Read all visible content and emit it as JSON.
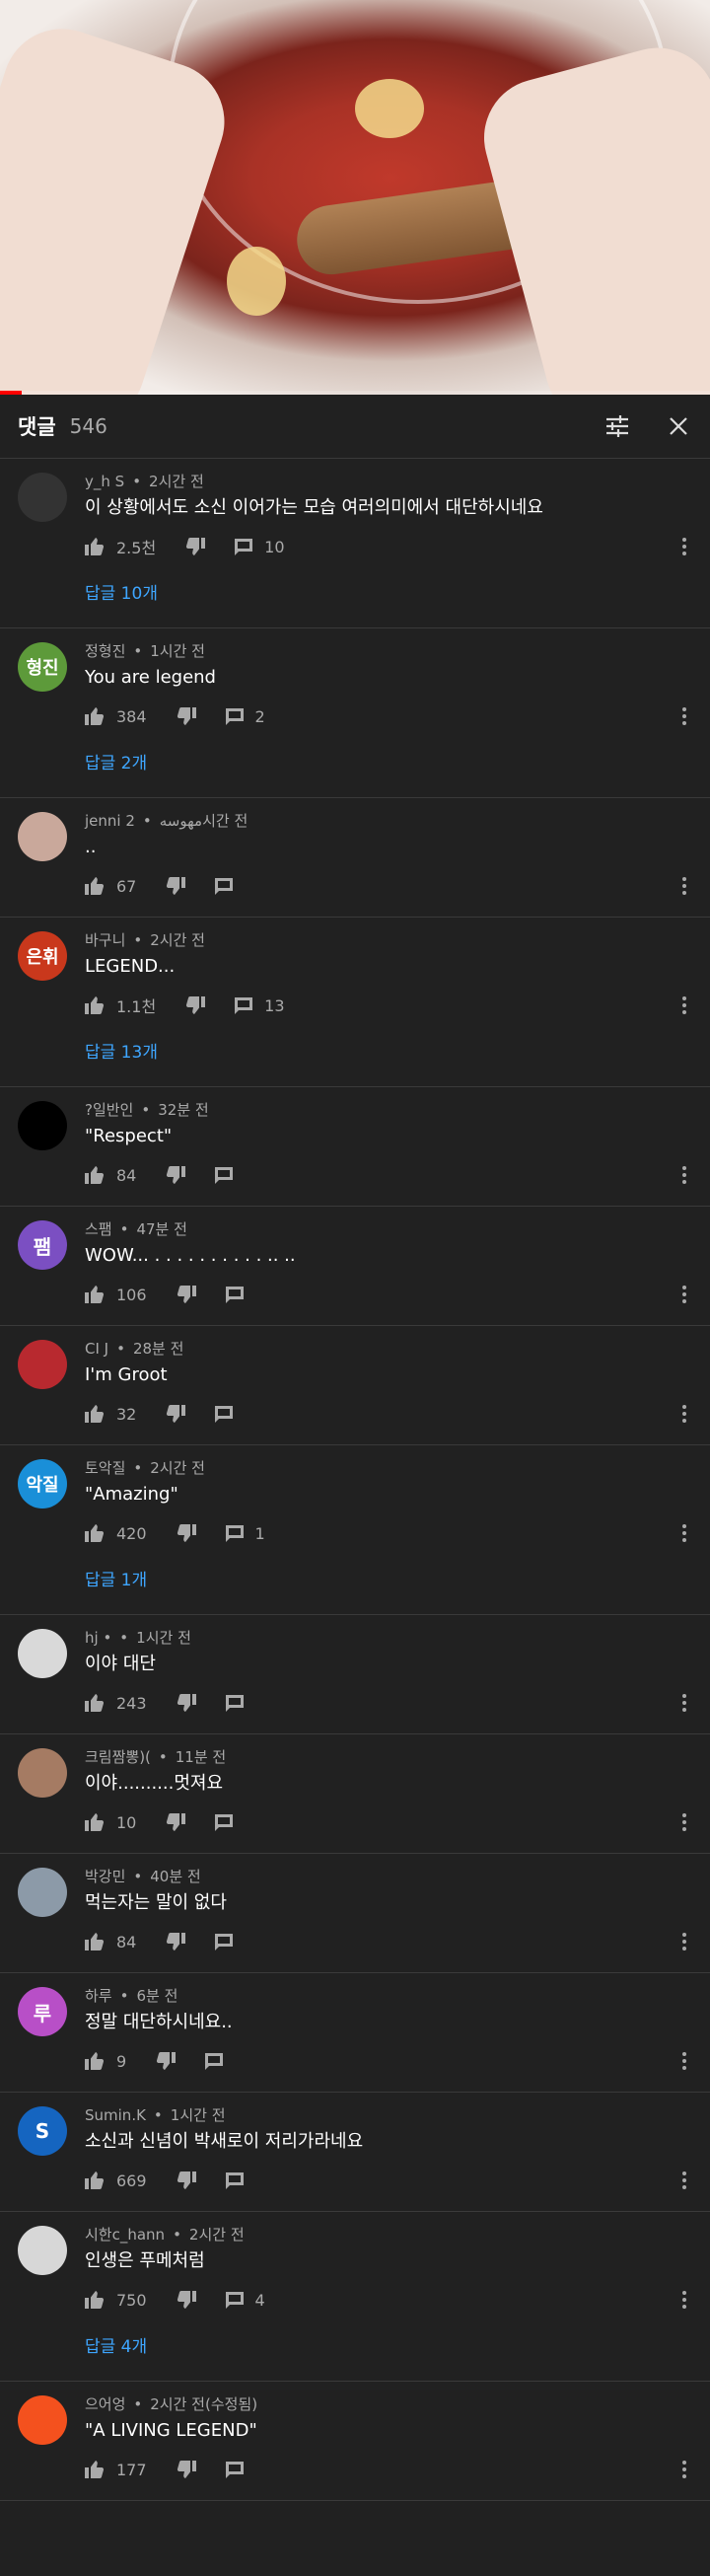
{
  "header": {
    "title": "댓글",
    "count": "546",
    "filter_icon": "filter-icon",
    "close_icon": "close-icon"
  },
  "video": {
    "progress_fraction": 0.03,
    "accent_color": "#ff0000"
  },
  "comments": [
    {
      "author": "y_h S",
      "time": "2시간 전",
      "text": "이 상황에서도 소신 이어가는 모습 여러의미에서 대단하시네요",
      "likes": "2.5천",
      "replies_count": "10",
      "replies_label": "답글 10개",
      "avatar_letter": "",
      "avatar_color": "#333333"
    },
    {
      "author": "정형진",
      "time": "1시간 전",
      "text": "You are legend",
      "likes": "384",
      "replies_count": "2",
      "replies_label": "답글 2개",
      "avatar_letter": "형진",
      "avatar_color": "#5d9a3a"
    },
    {
      "author": "jenni مهوسه",
      "time": "2시간 전",
      "text": "..",
      "likes": "67",
      "replies_count": "",
      "replies_label": "",
      "avatar_letter": "",
      "avatar_color": "#c9a89b"
    },
    {
      "author": "바구니",
      "time": "2시간 전",
      "text": "LEGEND...",
      "likes": "1.1천",
      "replies_count": "13",
      "replies_label": "답글 13개",
      "avatar_letter": "은휘",
      "avatar_color": "#c9381c"
    },
    {
      "author": "?일반인",
      "time": "32분 전",
      "text": "\"Respect\"",
      "likes": "84",
      "replies_count": "",
      "replies_label": "",
      "avatar_letter": "",
      "avatar_color": "#000000"
    },
    {
      "author": "스팸",
      "time": "47분 전",
      "text": "WOW... . . . . . . . . . . .. ..",
      "likes": "106",
      "replies_count": "",
      "replies_label": "",
      "avatar_letter": "팸",
      "avatar_color": "#7b4fc2"
    },
    {
      "author": "CI J",
      "time": "28분 전",
      "text": "I'm Groot",
      "likes": "32",
      "replies_count": "",
      "replies_label": "",
      "avatar_letter": "",
      "avatar_color": "#b8292f"
    },
    {
      "author": "토악질",
      "time": "2시간 전",
      "text": "\"Amazing\"",
      "likes": "420",
      "replies_count": "1",
      "replies_label": "답글 1개",
      "avatar_letter": "악질",
      "avatar_color": "#1a8fd8"
    },
    {
      "author": "hj •",
      "time": "1시간 전",
      "text": "이야 대단",
      "likes": "243",
      "replies_count": "",
      "replies_label": "",
      "avatar_letter": "",
      "avatar_color": "#d9d9d9"
    },
    {
      "author": "크림짬뽕)(",
      "time": "11분 전",
      "text": "이야..........멋져요",
      "likes": "10",
      "replies_count": "",
      "replies_label": "",
      "avatar_letter": "",
      "avatar_color": "#a57b63"
    },
    {
      "author": "박강민",
      "time": "40분 전",
      "text": "먹는자는 말이 없다",
      "likes": "84",
      "replies_count": "",
      "replies_label": "",
      "avatar_letter": "",
      "avatar_color": "#8c9aa8"
    },
    {
      "author": "하루",
      "time": "6분 전",
      "text": "정말 대단하시네요..",
      "likes": "9",
      "replies_count": "",
      "replies_label": "",
      "avatar_letter": "루",
      "avatar_color": "#b84fc7"
    },
    {
      "author": "Sumin.K",
      "time": "1시간 전",
      "text": "소신과 신념이 박새로이 저리가라네요",
      "likes": "669",
      "replies_count": "",
      "replies_label": "",
      "avatar_letter": "S",
      "avatar_color": "#1565c0"
    },
    {
      "author": "시한c_hann",
      "time": "2시간 전",
      "text": "인생은 푸메처럼",
      "likes": "750",
      "replies_count": "4",
      "replies_label": "답글 4개",
      "avatar_letter": "",
      "avatar_color": "#d7d7d7"
    },
    {
      "author": "으어엉",
      "time": "2시간 전(수정됨)",
      "text": "\"A LIVING LEGEND\"",
      "likes": "177",
      "replies_count": "",
      "replies_label": "",
      "avatar_letter": "",
      "avatar_color": "#f4511e"
    }
  ]
}
